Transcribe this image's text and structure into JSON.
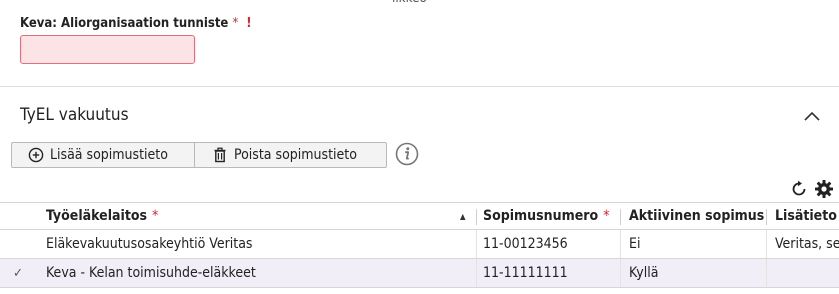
{
  "top_cut_text": "ilkkeo",
  "field": {
    "label": "Keva: Aliorganisaation tunniste",
    "required_marker": "*",
    "error_marker": "!",
    "value": ""
  },
  "section": {
    "title": "TyEL vakuutus",
    "buttons": {
      "add_label": "Lisää sopimustieto",
      "remove_label": "Poista sopimustieto"
    }
  },
  "table": {
    "columns": [
      {
        "label": "Työeläkelaitos",
        "required": "*"
      },
      {
        "label": "Sopimusnumero",
        "required": "*"
      },
      {
        "label": "Aktiivinen sopimus",
        "required": ""
      },
      {
        "label": "Lisätieto",
        "required": ""
      }
    ],
    "rows": [
      {
        "check": "",
        "laitos": "Eläkevakuutusosakeyhtiö Veritas",
        "numero": "11-00123456",
        "aktiivinen": "Ei",
        "lisatieto": "Veritas, se"
      },
      {
        "check": "✓",
        "laitos": "Keva - Kelan toimisuhde-eläkkeet",
        "numero": "11-11111111",
        "aktiivinen": "Kyllä",
        "lisatieto": ""
      }
    ]
  },
  "colors": {
    "error": "#d9232e",
    "invalid_bg": "#fbe3e6",
    "selected_row": "#f2eef7"
  }
}
